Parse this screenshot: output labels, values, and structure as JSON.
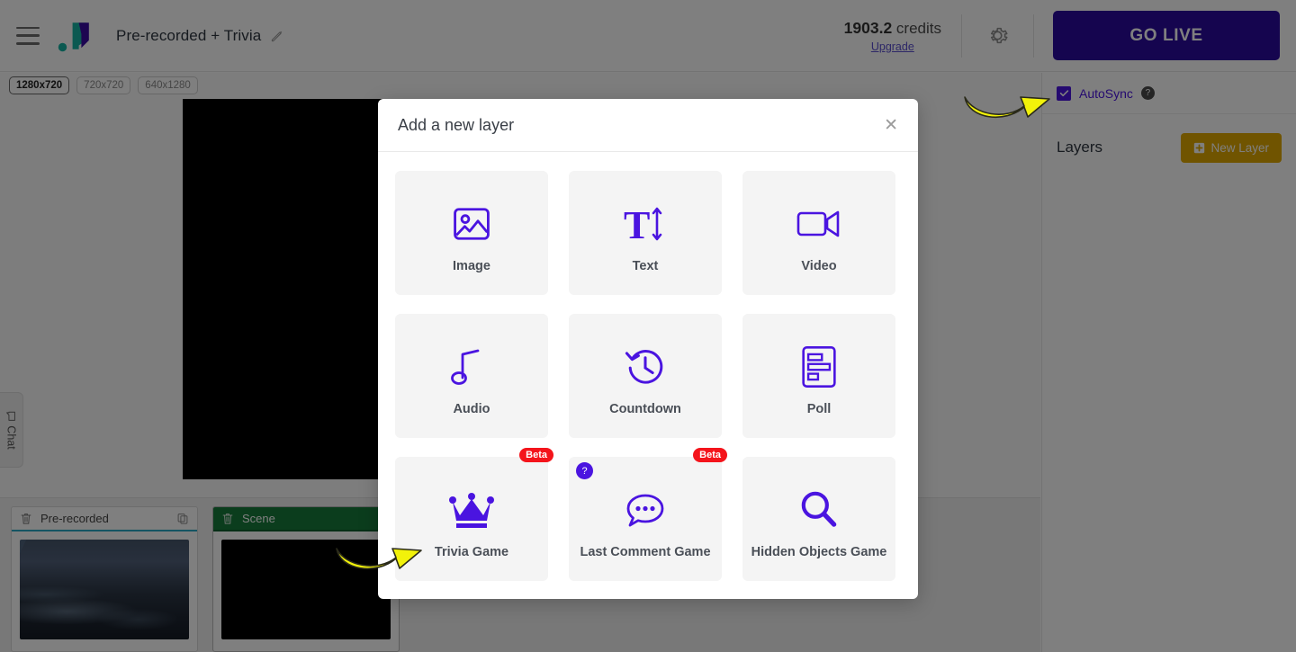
{
  "header": {
    "menu_icon": "hamburger-icon",
    "logo_icon": "brand-logo-icon",
    "title": "Pre-recorded + Trivia",
    "edit_icon": "pencil-icon",
    "credits_value": "1903.2",
    "credits_unit": "credits",
    "upgrade_label": "Upgrade",
    "settings_icon": "gear-icon",
    "go_live_label": "GO LIVE"
  },
  "workspace": {
    "resolutions": [
      {
        "label": "1280x720",
        "active": true
      },
      {
        "label": "720x720",
        "active": false
      },
      {
        "label": "640x1280",
        "active": false
      }
    ],
    "chat_tab_label": "Chat",
    "chat_tab_icon": "chat-bubble-icon"
  },
  "timeline": {
    "scenes": [
      {
        "name": "Pre-recorded",
        "delete_icon": "trash-icon",
        "copy_icon": "duplicate-icon",
        "thumb": "city",
        "selected": false
      },
      {
        "name": "Scene",
        "delete_icon": "trash-icon",
        "copy_icon": "",
        "thumb": "black",
        "selected": true
      }
    ]
  },
  "right_panel": {
    "autosync_label": "AutoSync",
    "autosync_checked": true,
    "autosync_help_icon": "question-mark-icon",
    "layers_label": "Layers",
    "new_layer_label": "New Layer",
    "new_layer_icon": "plus-square-icon",
    "new_layer_color": "#e0a800",
    "accent_color": "#4a14e0"
  },
  "modal": {
    "title": "Add a new layer",
    "close_icon": "close-icon",
    "accent_color": "#4a14e0",
    "beta_badge_color": "#f4141b",
    "cards": [
      {
        "label": "Image",
        "icon": "image-icon",
        "badge": "",
        "help": false
      },
      {
        "label": "Text",
        "icon": "text-size-icon",
        "badge": "",
        "help": false
      },
      {
        "label": "Video",
        "icon": "video-camera-icon",
        "badge": "",
        "help": false
      },
      {
        "label": "Audio",
        "icon": "music-note-icon",
        "badge": "",
        "help": false
      },
      {
        "label": "Countdown",
        "icon": "clock-rewind-icon",
        "badge": "",
        "help": false
      },
      {
        "label": "Poll",
        "icon": "poll-bars-icon",
        "badge": "",
        "help": false
      },
      {
        "label": "Trivia Game",
        "icon": "crown-icon",
        "badge": "Beta",
        "help": false
      },
      {
        "label": "Last Comment Game",
        "icon": "speech-bubble-icon",
        "badge": "Beta",
        "help": true
      },
      {
        "label": "Hidden Objects Game",
        "icon": "magnifier-icon",
        "badge": "",
        "help": false
      }
    ]
  },
  "annotations": {
    "arrow_color": "#f2f20a",
    "arrow_autosync": "arrow-pointing-to-autosync",
    "arrow_trivia": "arrow-pointing-to-trivia-game"
  }
}
